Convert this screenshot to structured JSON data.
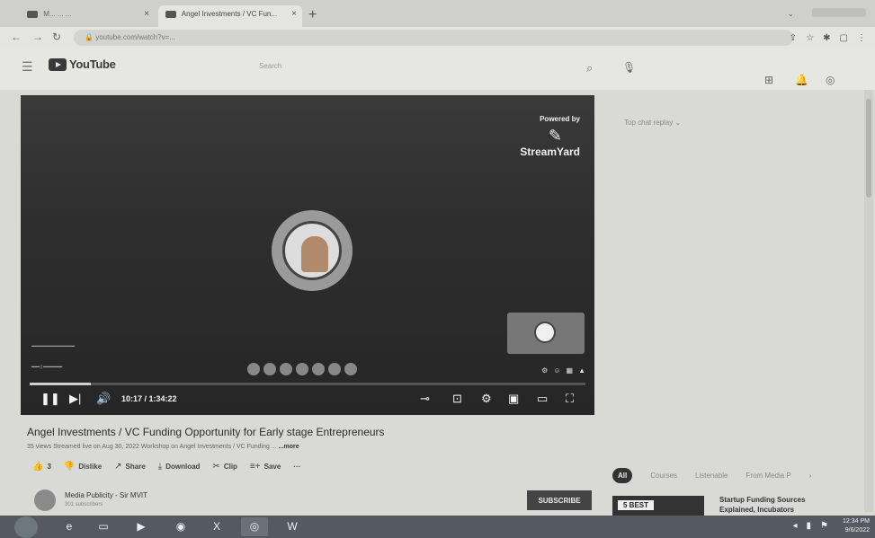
{
  "browser": {
    "tabs": [
      {
        "label": "M... ... ..."
      },
      {
        "label": "Angel Investments / VC Fun..."
      }
    ],
    "new_tab": "+",
    "url": "youtube.com/watch?v=..."
  },
  "youtube": {
    "logo_text": "YouTube",
    "search_placeholder": "Search"
  },
  "player": {
    "powered_by": "Powered by",
    "brand": "StreamYard",
    "elapsed_time": "10:17 / 1:34:22",
    "progress": 0.11
  },
  "video": {
    "title": "Angel Investments / VC Funding Opportunity for Early stage Entrepreneurs",
    "meta": "35 views  Streamed live on Aug 30, 2022  Workshop on Angel Investments / VC Funding ...",
    "more": "...more",
    "likes": "3",
    "dislike": "Dislike",
    "share": "Share",
    "download": "Download",
    "clip": "Clip",
    "save": "Save",
    "more_actions": "···"
  },
  "channel": {
    "name": "Media Publicity - Sir MVIT",
    "subscribers": "301 subscribers",
    "subscribe": "SUBSCRIBE"
  },
  "sidebar": {
    "chat_replay": "Top chat replay",
    "chips": [
      "All",
      "Courses",
      "Listenable",
      "From Media P"
    ],
    "rec_label": "5 BEST",
    "rec_title": "Startup Funding Sources Explained, Incubators"
  },
  "taskbar": {
    "time": "12:34 PM",
    "date": "9/6/2022"
  }
}
